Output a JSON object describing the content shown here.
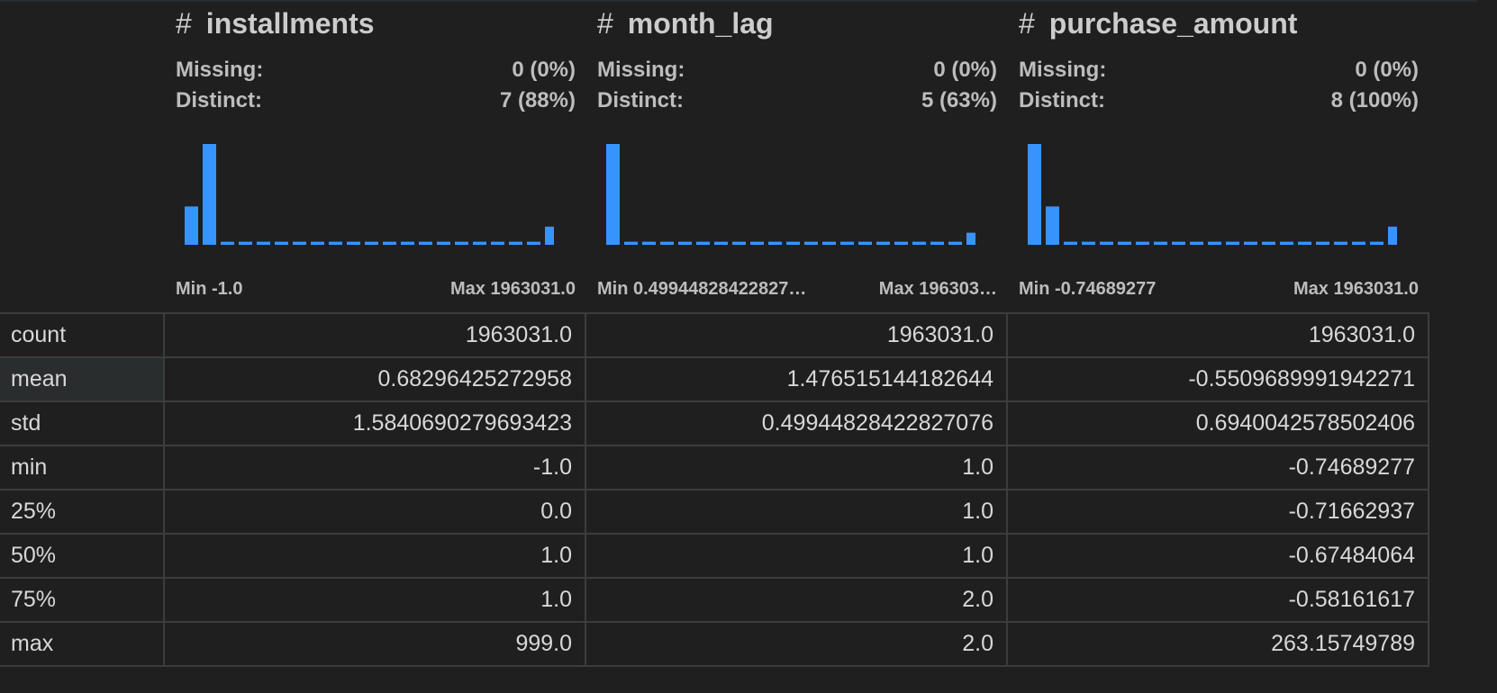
{
  "columns": [
    {
      "name": "installments",
      "missing_label": "Missing:",
      "missing_value": "0 (0%)",
      "distinct_label": "Distinct:",
      "distinct_value": "7 (88%)",
      "min_label": "Min -1.0",
      "max_label": "Max 1963031.0",
      "histogram": [
        0.38,
        1.0,
        0.03,
        0.03,
        0.03,
        0.03,
        0.03,
        0.03,
        0.03,
        0.03,
        0.03,
        0.03,
        0.03,
        0.03,
        0.03,
        0.03,
        0.03,
        0.03,
        0.03,
        0.03,
        0.18
      ]
    },
    {
      "name": "month_lag",
      "missing_label": "Missing:",
      "missing_value": "0 (0%)",
      "distinct_label": "Distinct:",
      "distinct_value": "5 (63%)",
      "min_label": "Min 0.49944828422827…",
      "max_label": "Max 196303…",
      "histogram": [
        1.0,
        0.03,
        0.03,
        0.03,
        0.03,
        0.03,
        0.03,
        0.03,
        0.03,
        0.03,
        0.03,
        0.03,
        0.03,
        0.03,
        0.03,
        0.03,
        0.03,
        0.03,
        0.03,
        0.03,
        0.12
      ]
    },
    {
      "name": "purchase_amount",
      "missing_label": "Missing:",
      "missing_value": "0 (0%)",
      "distinct_label": "Distinct:",
      "distinct_value": "8 (100%)",
      "min_label": "Min -0.74689277",
      "max_label": "Max 1963031.0",
      "histogram": [
        1.0,
        0.38,
        0.03,
        0.03,
        0.03,
        0.03,
        0.03,
        0.03,
        0.03,
        0.03,
        0.03,
        0.03,
        0.03,
        0.03,
        0.03,
        0.03,
        0.03,
        0.03,
        0.03,
        0.03,
        0.18
      ]
    }
  ],
  "rows": [
    {
      "label": "count",
      "values": [
        "1963031.0",
        "1963031.0",
        "1963031.0"
      ]
    },
    {
      "label": "mean",
      "values": [
        "0.68296425272958",
        "1.476515144182644",
        "-0.5509689991942271"
      ]
    },
    {
      "label": "std",
      "values": [
        "1.5840690279693423",
        "0.49944828422827076",
        "0.6940042578502406"
      ]
    },
    {
      "label": "min",
      "values": [
        "-1.0",
        "1.0",
        "-0.74689277"
      ]
    },
    {
      "label": "25%",
      "values": [
        "0.0",
        "1.0",
        "-0.71662937"
      ]
    },
    {
      "label": "50%",
      "values": [
        "1.0",
        "1.0",
        "-0.67484064"
      ]
    },
    {
      "label": "75%",
      "values": [
        "1.0",
        "2.0",
        "-0.58161617"
      ]
    },
    {
      "label": "max",
      "values": [
        "999.0",
        "2.0",
        "263.15749789"
      ]
    }
  ],
  "hash_symbol": "#",
  "colors": {
    "bar": "#3794ff",
    "border": "#3c3c3c",
    "background": "#1f1f1f",
    "hover_row": "#2a2d2e"
  }
}
